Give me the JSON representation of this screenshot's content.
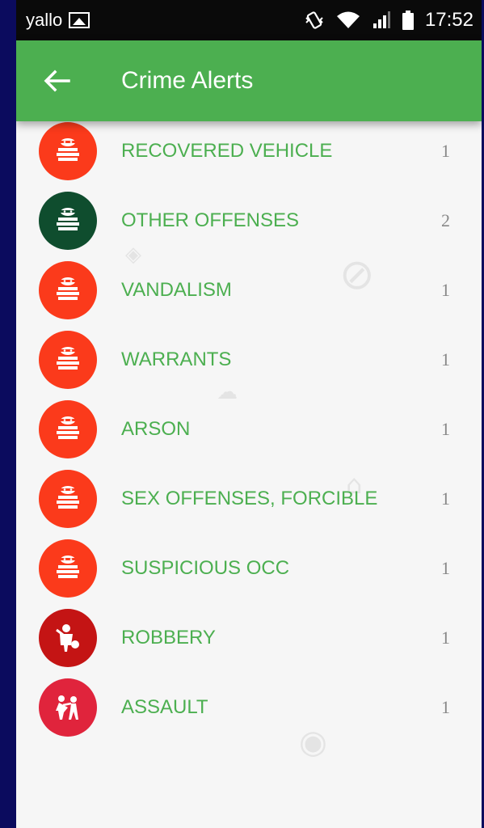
{
  "status_bar": {
    "carrier": "yallo",
    "time": "17:52"
  },
  "app_bar": {
    "title": "Crime Alerts"
  },
  "alerts": [
    {
      "label": "RECOVERED VEHICLE",
      "count": "1",
      "color": "#fb3a1b",
      "icon": "thief-icon"
    },
    {
      "label": "OTHER OFFENSES",
      "count": "2",
      "color": "#0f4d2e",
      "icon": "thief-icon"
    },
    {
      "label": "VANDALISM",
      "count": "1",
      "color": "#fb3a1b",
      "icon": "thief-icon"
    },
    {
      "label": "WARRANTS",
      "count": "1",
      "color": "#fb3a1b",
      "icon": "thief-icon"
    },
    {
      "label": "ARSON",
      "count": "1",
      "color": "#fb3a1b",
      "icon": "thief-icon"
    },
    {
      "label": "SEX OFFENSES, FORCIBLE",
      "count": "1",
      "color": "#fb3a1b",
      "icon": "thief-icon"
    },
    {
      "label": "SUSPICIOUS OCC",
      "count": "1",
      "color": "#fb3a1b",
      "icon": "thief-icon"
    },
    {
      "label": "ROBBERY",
      "count": "1",
      "color": "#c41414",
      "icon": "robber-icon"
    },
    {
      "label": "ASSAULT",
      "count": "1",
      "color": "#e0243c",
      "icon": "assault-icon"
    }
  ]
}
